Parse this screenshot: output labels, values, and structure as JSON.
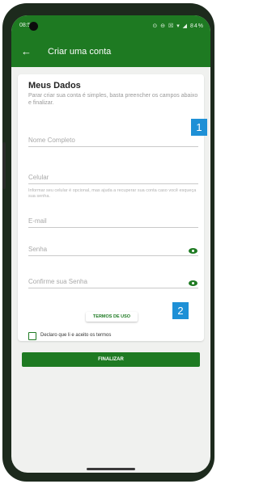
{
  "status_bar": {
    "time": "08:57",
    "icons": "⊙ ⊖ ☒ ▾ ◢ 84%"
  },
  "app_bar": {
    "back_icon": "←",
    "title": "Criar uma conta"
  },
  "form": {
    "heading": "Meus Dados",
    "subtitle": "Parar criar sua conta é simples, basta preencher os campos abaixo e finalizar.",
    "fields": {
      "nome": "Nome Completo",
      "celular": "Celular",
      "email": "E-mail",
      "senha": "Senha",
      "confirme": "Confirme sua Senha"
    },
    "celular_helper": "Informar seu celular é opcional, mas ajuda a recuperar sua conta caso você esqueça sua senha.",
    "terms_button": "TERMOS DE USO",
    "checkbox_label": "Declaro que li e aceito os termos"
  },
  "finalizar_button": "FINALIZAR",
  "annotations": {
    "one": "1",
    "two": "2"
  },
  "colors": {
    "primary": "#1e7a22",
    "annotation": "#1e90d6"
  }
}
